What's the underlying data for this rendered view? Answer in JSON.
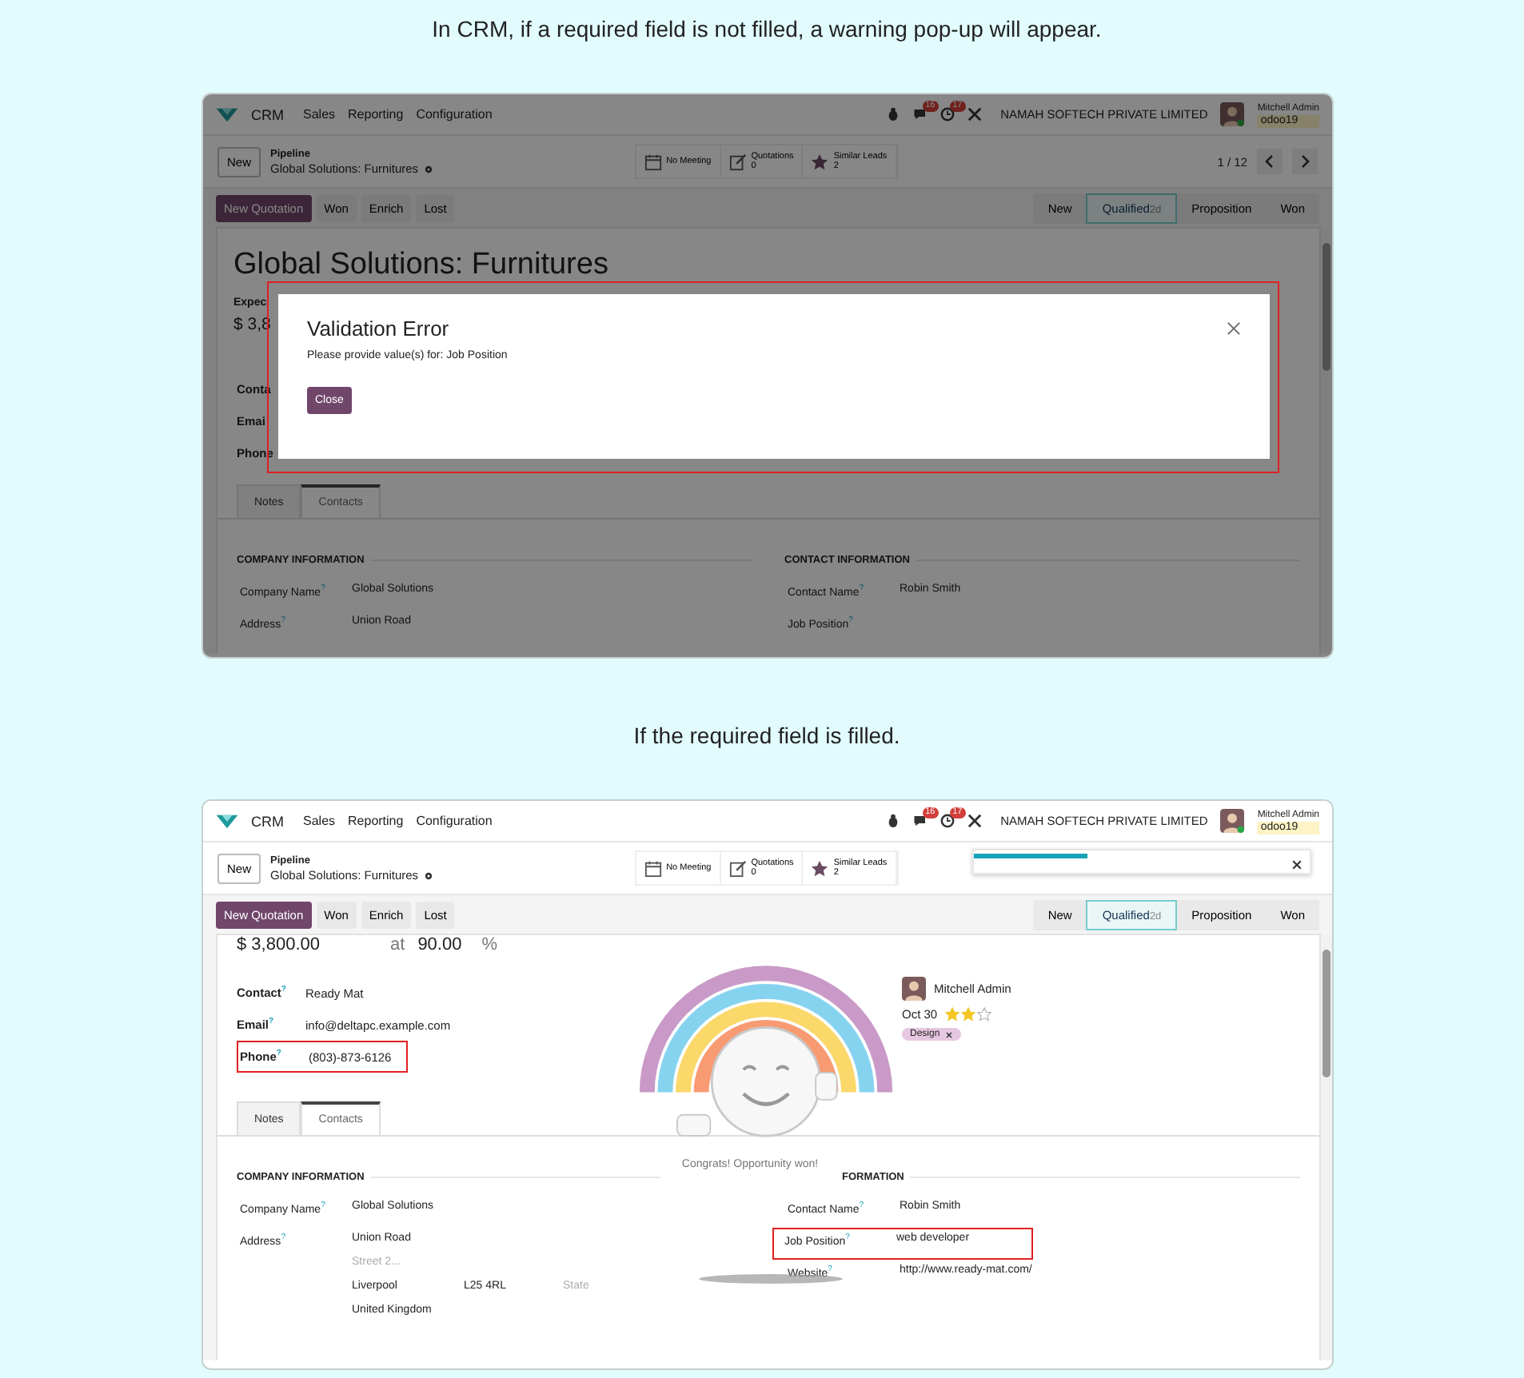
{
  "sections": [
    {
      "caption": "In CRM, if a required field is not filled, a warning pop-up will appear.",
      "screen": {
        "navbar": {
          "app": "CRM",
          "menu": [
            "Sales",
            "Reporting",
            "Configuration"
          ],
          "messages_badge": "16",
          "activities_badge": "17",
          "company": "NAMAH SOFTECH PRIVATE LIMITED",
          "user": "Mitchell Admin",
          "database": "odoo19"
        },
        "control": {
          "new_button": "New",
          "breadcrumb": "Pipeline",
          "record": "Global Solutions: Furnitures",
          "smart_buttons": [
            {
              "label": "No Meeting"
            },
            {
              "label": "Quotations",
              "count": "0"
            },
            {
              "label": "Similar Leads",
              "count": "2"
            }
          ],
          "pager": "1 / 12"
        },
        "actions": [
          {
            "label": "New Quotation",
            "primary": true
          },
          {
            "label": "Won",
            "primary": false
          },
          {
            "label": "Enrich",
            "primary": false
          },
          {
            "label": "Lost",
            "primary": false
          }
        ],
        "stages": [
          {
            "label": "New",
            "selected": false
          },
          {
            "label": "Qualified",
            "selected": true,
            "duration": "2d"
          },
          {
            "label": "Proposition",
            "selected": false
          },
          {
            "label": "Won",
            "selected": false
          }
        ],
        "form": {
          "title": "Global Solutions: Furnitures",
          "expected_label": "Expec",
          "expected_amount": "$ 3,8",
          "fields": [
            {
              "label": "Conta"
            },
            {
              "label": "Emai"
            },
            {
              "label": "Phone"
            }
          ]
        },
        "tabs": [
          {
            "label": "Notes",
            "selected": false
          },
          {
            "label": "Contacts",
            "selected": true
          }
        ],
        "company_info": {
          "heading": "COMPANY INFORMATION",
          "rows": [
            {
              "label": "Company Name$^{?}$",
              "value": "Global Solutions",
              "highlighted": false
            },
            {
              "label": "Address$^{?}$",
              "value": "Union Road",
              "highlighted": false
            }
          ]
        },
        "contact_info": {
          "heading": "CONTACT INFORMATION",
          "rows": [
            {
              "label": "Contact Name$^{?}$",
              "value": "Robin Smith",
              "highlighted": false
            },
            {
              "label": "Job Position$^{?}$",
              "highlighted": false
            }
          ]
        },
        "dialog": {
          "title": "Validation Error",
          "message": "Please provide value(s) for: Job Position",
          "button": "Close",
          "highlighted": true
        }
      }
    },
    {
      "caption": "If the required field is filled.",
      "screen": {
        "navbar": {
          "app": "CRM",
          "menu": [
            "Sales",
            "Reporting",
            "Configuration"
          ],
          "messages_badge": "16",
          "activities_badge": "17",
          "company": "NAMAH SOFTECH PRIVATE LIMITED",
          "user": "Mitchell Admin",
          "database": "odoo19"
        },
        "control": {
          "new_button": "New",
          "breadcrumb": "Pipeline",
          "record": "Global Solutions: Furnitures",
          "smart_buttons": [
            {
              "label": "No Meeting"
            },
            {
              "label": "Quotations",
              "count": "0"
            },
            {
              "label": "Similar Leads",
              "count": "2"
            }
          ]
        },
        "notification": {
          "level": 0.35
        },
        "actions": [
          {
            "label": "New Quotation",
            "primary": true
          },
          {
            "label": "Won",
            "primary": false
          },
          {
            "label": "Enrich",
            "primary": false
          },
          {
            "label": "Lost",
            "primary": false
          }
        ],
        "stages": [
          {
            "label": "New",
            "selected": false
          },
          {
            "label": "Qualified",
            "selected": true,
            "duration": "2d"
          },
          {
            "label": "Proposition",
            "selected": false
          },
          {
            "label": "Won",
            "selected": false
          }
        ],
        "form": {
          "amount": "$ 3,800.00",
          "at": "at",
          "probability": "90.00",
          "percent": "%",
          "fields": [
            {
              "label": "Contact$^{?}$",
              "value": "Ready Mat",
              "highlighted": false
            },
            {
              "label": "Email$^{?}$",
              "value": "info@deltapc.example.com",
              "highlighted": false
            },
            {
              "label": "Phone$^{?}$",
              "value": "(803)-873-6126",
              "highlighted": true
            }
          ],
          "salesperson": "Mitchell Admin",
          "date": "Oct 30",
          "stars": 2,
          "tags": [
            {
              "label": "Design"
            }
          ]
        },
        "tabs": [
          {
            "label": "Notes",
            "selected": false
          },
          {
            "label": "Contacts",
            "selected": true
          }
        ],
        "company_info": {
          "heading": "COMPANY INFORMATION",
          "rows": [
            {
              "label": "Company Name$^{?}$",
              "value": "Global Solutions",
              "highlighted": false
            },
            {
              "label": "Address$^{?}$",
              "value": "Union Road",
              "street2_placeholder": "Street 2...",
              "city": "Liverpool",
              "zip": "L25 4RL",
              "state_placeholder": "State",
              "country": "United Kingdom",
              "highlighted": false
            }
          ]
        },
        "contact_info": {
          "heading": "FORMATION",
          "rows": [
            {
              "label": "Contact Name$^{?}$",
              "value": "Robin Smith",
              "highlighted": false
            },
            {
              "label": "Job Position$^{?}$",
              "value": "web developer",
              "highlighted": true
            },
            {
              "label": "Website$^{?}$",
              "value": "http://www.ready-mat.com/",
              "highlighted": false
            }
          ]
        },
        "rainbow": {
          "message": "Congrats! Opportunity won!"
        }
      }
    }
  ]
}
